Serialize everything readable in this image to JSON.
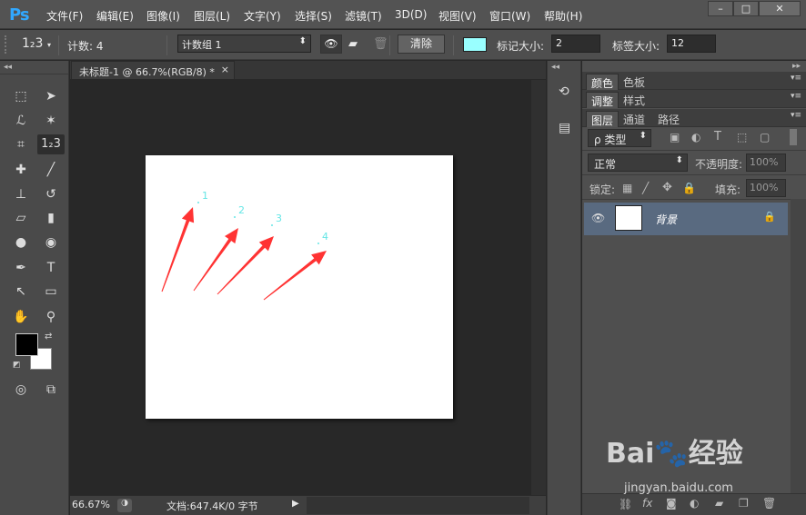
{
  "app": {
    "logo": "Ps",
    "menu": [
      "文件(F)",
      "编辑(E)",
      "图像(I)",
      "图层(L)",
      "文字(Y)",
      "选择(S)",
      "滤镜(T)",
      "3D(D)",
      "视图(V)",
      "窗口(W)",
      "帮助(H)"
    ],
    "window_buttons": [
      "–",
      "□",
      "✕"
    ]
  },
  "options": {
    "tool_label": "1₂3",
    "count_label": "计数: 4",
    "group_value": "计数组 1",
    "clear_button": "清除",
    "marker_size_label": "标记大小:",
    "marker_size_value": "2",
    "label_size_label": "标签大小:",
    "label_size_value": "12",
    "marker_color": "#99ffff"
  },
  "document": {
    "tab_title": "未标题-1 @ 66.7%(RGB/8) *",
    "tab_close": "×",
    "count_labels": [
      "1",
      "2",
      "3",
      "4"
    ],
    "arrow_color": "#ff3333",
    "label_color": "#66e6e6"
  },
  "status": {
    "zoom": "66.67%",
    "doc_info": "文档:647.4K/0 字节"
  },
  "panels": {
    "row1_tabs": [
      "颜色",
      "色板"
    ],
    "row2_tabs": [
      "调整",
      "样式"
    ],
    "row3_tabs": [
      "图层",
      "通道",
      "路径"
    ],
    "filter_label": "ρ 类型",
    "blend_mode": "正常",
    "opacity_label": "不透明度:",
    "opacity_value": "100%",
    "lock_label": "锁定:",
    "fill_label": "填充:",
    "fill_value": "100%",
    "layer_name": "背景"
  },
  "watermark": {
    "brand": "Bai🐾经验",
    "url": "jingyan.baidu.com"
  }
}
